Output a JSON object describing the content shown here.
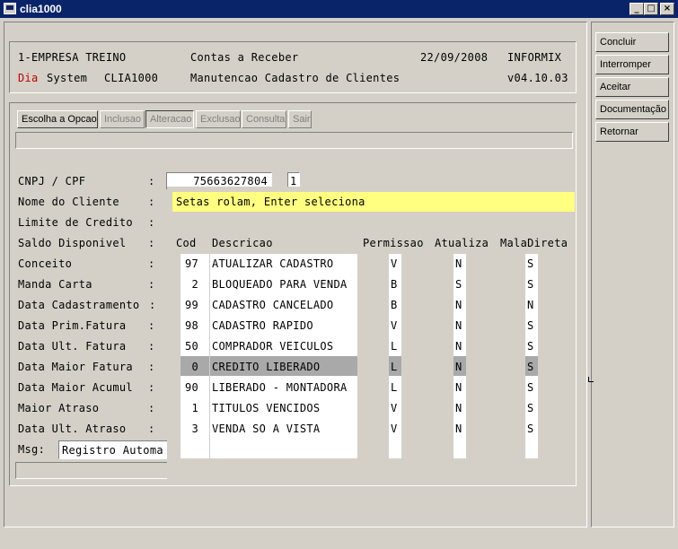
{
  "window": {
    "title": "clia1000",
    "minimize": "_",
    "maximize": "□",
    "close": "×"
  },
  "header": {
    "company": "1-EMPRESA TREINO",
    "module": "Contas a Receber",
    "date": "22/09/2008",
    "db": "INFORMIX",
    "dia": "Dia",
    "system": "System",
    "program": "CLIA1000",
    "screen_title": "Manutencao Cadastro de Clientes",
    "version": "v04.10.03"
  },
  "side_buttons": [
    "Concluir",
    "Interromper",
    "Aceitar",
    "Documentação",
    "Retornar"
  ],
  "toolbar": [
    "Escolha a Opcao",
    "Inclusao",
    "Alteracao",
    "Exclusao",
    "Consulta",
    "Sair"
  ],
  "form": {
    "labels": [
      "CNPJ / CPF",
      "Nome do Cliente",
      "Limite de Credito",
      "Saldo Disponivel",
      "Conceito",
      "Manda Carta",
      "Data Cadastramento",
      "Data Prim.Fatura",
      "Data Ult. Fatura",
      "Data Maior Fatura",
      "Data Maior Acumul",
      "Maior Atraso",
      "Data Ult. Atraso"
    ],
    "cnpj": "75663627804",
    "cnpj_suffix": "1",
    "msg_label": "Msg:",
    "msg_value": "Registro Automa"
  },
  "popup": {
    "hint": "Setas rolam, Enter seleciona",
    "columns": [
      "Cod",
      "Descricao",
      "Permissao",
      "Atualiza",
      "MalaDireta"
    ],
    "rows": [
      {
        "cod": "97",
        "desc": "ATUALIZAR CADASTRO",
        "perm": "V",
        "atual": "N",
        "mala": "S"
      },
      {
        "cod": "2",
        "desc": "BLOQUEADO PARA VENDA",
        "perm": "B",
        "atual": "S",
        "mala": "S"
      },
      {
        "cod": "99",
        "desc": "CADASTRO CANCELADO",
        "perm": "B",
        "atual": "N",
        "mala": "N"
      },
      {
        "cod": "98",
        "desc": "CADASTRO RAPIDO",
        "perm": "V",
        "atual": "N",
        "mala": "S"
      },
      {
        "cod": "50",
        "desc": "COMPRADOR VEICULOS",
        "perm": "L",
        "atual": "N",
        "mala": "S"
      },
      {
        "cod": "0",
        "desc": "CREDITO LIBERADO",
        "perm": "L",
        "atual": "N",
        "mala": "S"
      },
      {
        "cod": "90",
        "desc": "LIBERADO - MONTADORA",
        "perm": "L",
        "atual": "N",
        "mala": "S"
      },
      {
        "cod": "1",
        "desc": "TITULOS VENCIDOS",
        "perm": "V",
        "atual": "N",
        "mala": "S"
      },
      {
        "cod": "3",
        "desc": "VENDA SO A VISTA",
        "perm": "V",
        "atual": "N",
        "mala": "S"
      }
    ],
    "selected_row": 5
  }
}
